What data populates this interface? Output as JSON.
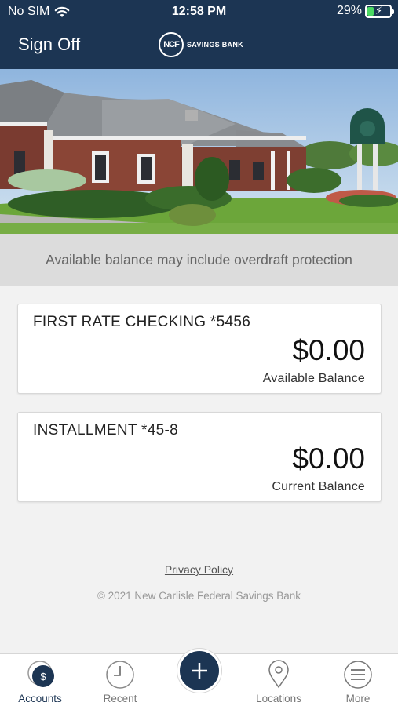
{
  "status_bar": {
    "carrier": "No SIM",
    "time": "12:58 PM",
    "battery": "29%",
    "battery_level": 0.29
  },
  "nav": {
    "sign_off_label": "Sign Off",
    "logo_mark": "NCF",
    "logo_text": "SAVINGS BANK"
  },
  "notice": "Available balance may include overdraft protection",
  "accounts": [
    {
      "name": "FIRST RATE CHECKING *5456",
      "amount": "$0.00",
      "balance_label": "Available Balance"
    },
    {
      "name": "INSTALLMENT *45-8",
      "amount": "$0.00",
      "balance_label": "Current Balance"
    }
  ],
  "footer": {
    "privacy_label": "Privacy Policy",
    "copyright": "© 2021 New Carlisle Federal Savings Bank"
  },
  "tabbar": {
    "tabs": [
      {
        "label": "Accounts",
        "icon": "accounts-dollar-icon",
        "active": true
      },
      {
        "label": "Recent",
        "icon": "clock-icon"
      },
      {
        "label": "Locations",
        "icon": "map-pin-icon"
      },
      {
        "label": "More",
        "icon": "menu-icon"
      }
    ],
    "fab_icon": "plus-icon"
  },
  "colors": {
    "navy": "#1c3553",
    "battery_green": "#4cd964"
  }
}
